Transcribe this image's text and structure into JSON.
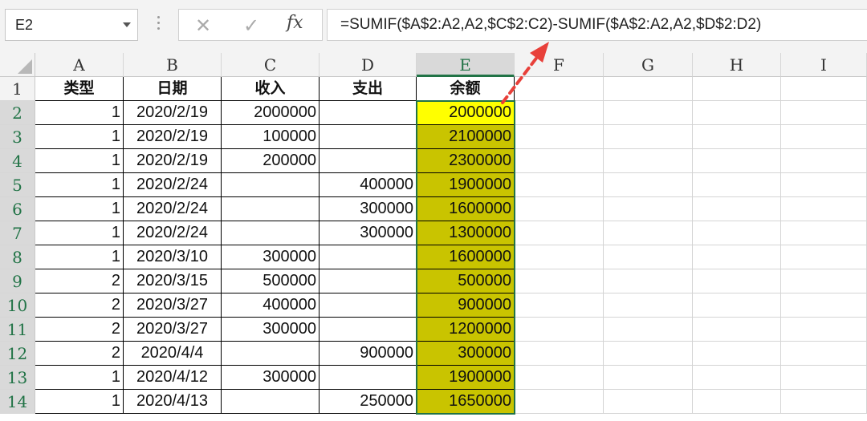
{
  "name_box": {
    "value": "E2"
  },
  "formula_bar": {
    "cancel_glyph": "✕",
    "enter_glyph": "✓",
    "fx_label": "fx",
    "formula": "=SUMIF($A$2:A2,A2,$C$2:C2)-SUMIF($A$2:A2,A2,$D$2:D2)"
  },
  "columns": [
    "A",
    "B",
    "C",
    "D",
    "E",
    "F",
    "G",
    "H",
    "I"
  ],
  "selected_column": "E",
  "headers": {
    "A": "类型",
    "B": "日期",
    "C": "收入",
    "D": "支出",
    "E": "余额"
  },
  "rows": [
    {
      "row": "1"
    },
    {
      "row": "2",
      "A": "1",
      "B": "2020/2/19",
      "C": "2000000",
      "D": "",
      "E": "2000000"
    },
    {
      "row": "3",
      "A": "1",
      "B": "2020/2/19",
      "C": "100000",
      "D": "",
      "E": "2100000"
    },
    {
      "row": "4",
      "A": "1",
      "B": "2020/2/19",
      "C": "200000",
      "D": "",
      "E": "2300000"
    },
    {
      "row": "5",
      "A": "1",
      "B": "2020/2/24",
      "C": "",
      "D": "400000",
      "E": "1900000"
    },
    {
      "row": "6",
      "A": "1",
      "B": "2020/2/24",
      "C": "",
      "D": "300000",
      "E": "1600000"
    },
    {
      "row": "7",
      "A": "1",
      "B": "2020/2/24",
      "C": "",
      "D": "300000",
      "E": "1300000"
    },
    {
      "row": "8",
      "A": "1",
      "B": "2020/3/10",
      "C": "300000",
      "D": "",
      "E": "1600000"
    },
    {
      "row": "9",
      "A": "2",
      "B": "2020/3/15",
      "C": "500000",
      "D": "",
      "E": "500000"
    },
    {
      "row": "10",
      "A": "2",
      "B": "2020/3/27",
      "C": "400000",
      "D": "",
      "E": "900000"
    },
    {
      "row": "11",
      "A": "2",
      "B": "2020/3/27",
      "C": "300000",
      "D": "",
      "E": "1200000"
    },
    {
      "row": "12",
      "A": "2",
      "B": "2020/4/4",
      "C": "",
      "D": "900000",
      "E": "300000"
    },
    {
      "row": "13",
      "A": "1",
      "B": "2020/4/12",
      "C": "300000",
      "D": "",
      "E": "1900000"
    },
    {
      "row": "14",
      "A": "1",
      "B": "2020/4/13",
      "C": "",
      "D": "250000",
      "E": "1650000"
    }
  ],
  "colors": {
    "active_cell": "#ffff00",
    "range_fill": "#c9c400",
    "selection": "#217346",
    "annotation_arrow": "#e8403a"
  },
  "annotation": {
    "type": "dashed-arrow",
    "from": "E2",
    "to": "formula_bar"
  }
}
